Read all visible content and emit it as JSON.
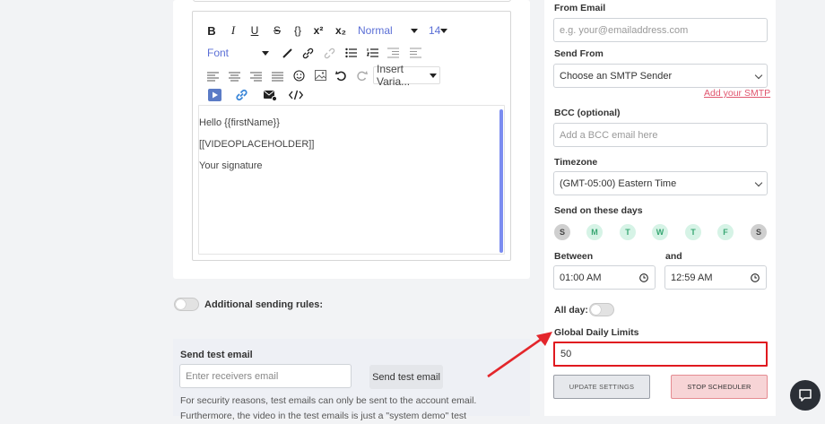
{
  "editor": {
    "format_select": "Normal",
    "size_select": "14",
    "font_select": "Font",
    "insert_variable": "Insert Varia...",
    "lines": [
      "Hello {{firstName}}",
      "[[VIDEOPLACEHOLDER]]",
      "Your signature"
    ]
  },
  "additional_rules": {
    "label": "Additional sending rules:"
  },
  "test_email": {
    "title": "Send test email",
    "placeholder": "Enter receivers email",
    "button": "Send test email",
    "note_line1": "For security reasons, test emails can only be sent to the account email.",
    "note_line2": "Furthermore, the video in the test emails is just a \"system demo\" test"
  },
  "settings": {
    "from_email": {
      "label": "From Email",
      "placeholder": "e.g. your@emailaddress.com"
    },
    "send_from": {
      "label": "Send From",
      "value": "Choose an SMTP Sender",
      "link": "Add your SMTP"
    },
    "bcc": {
      "label": "BCC (optional)",
      "placeholder": "Add a BCC email here"
    },
    "timezone": {
      "label": "Timezone",
      "value": "(GMT-05:00) Eastern Time"
    },
    "days": {
      "label": "Send on these days",
      "items": [
        {
          "letter": "S",
          "active": false
        },
        {
          "letter": "M",
          "active": true
        },
        {
          "letter": "T",
          "active": true
        },
        {
          "letter": "W",
          "active": true
        },
        {
          "letter": "T",
          "active": true
        },
        {
          "letter": "F",
          "active": true
        },
        {
          "letter": "S",
          "active": false
        }
      ]
    },
    "between": {
      "label": "Between",
      "value": "01:00 AM"
    },
    "and": {
      "label": "and",
      "value": "12:59 AM"
    },
    "all_day": {
      "label": "All day:"
    },
    "daily_limit": {
      "label": "Global Daily Limits",
      "value": "50"
    },
    "update_button": "UPDATE SETTINGS",
    "stop_button": "STOP SCHEDULER"
  },
  "colors": {
    "accent_link": "#e0556e",
    "highlight_border": "#e0191f",
    "annotation_arrow": "#e3262b",
    "active_day": "#d6f3e6"
  }
}
